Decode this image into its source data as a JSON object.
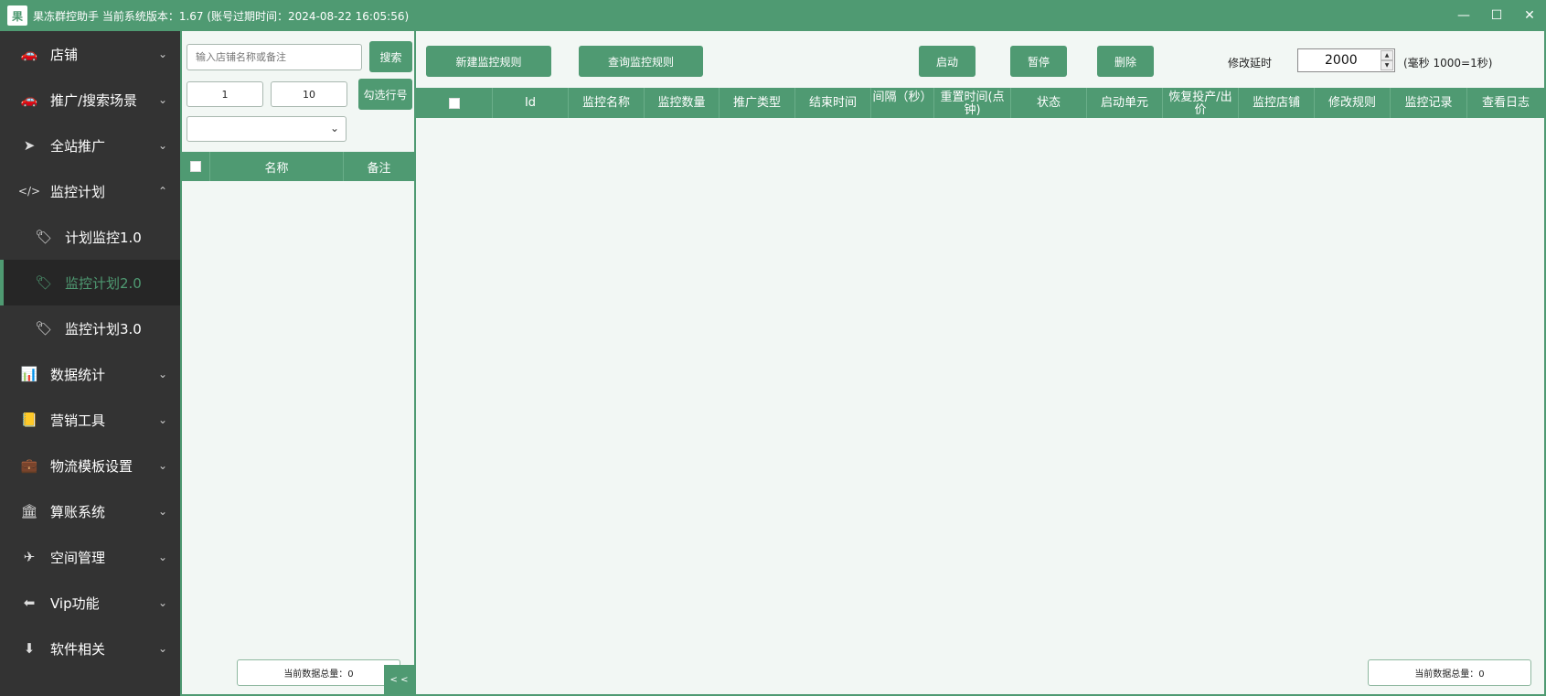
{
  "window": {
    "title": "果冻群控助手 当前系统版本：1.67  (账号过期时间：2024-08-22 16:05:56)",
    "logo_text": "果",
    "controls": {
      "minimize": "—",
      "maximize": "☐",
      "close": "✕"
    }
  },
  "sidebar": {
    "items": [
      {
        "label": "店铺",
        "icon": "car-icon",
        "glyph": "🚗",
        "chevron": "⌄"
      },
      {
        "label": "推广/搜索场景",
        "icon": "car-icon",
        "glyph": "🚗",
        "chevron": "⌄"
      },
      {
        "label": "全站推广",
        "icon": "location-arrow-icon",
        "glyph": "➤",
        "chevron": "⌄"
      },
      {
        "label": "监控计划",
        "icon": "code-icon",
        "glyph": "</>",
        "chevron": "⌃"
      },
      {
        "label": "计划监控1.0",
        "icon": "tag-icon",
        "glyph": "🏷"
      },
      {
        "label": "监控计划2.0",
        "icon": "tag-icon",
        "glyph": "🏷",
        "active": true
      },
      {
        "label": "监控计划3.0",
        "icon": "tag-icon",
        "glyph": "🏷"
      },
      {
        "label": "数据统计",
        "icon": "bar-chart-icon",
        "glyph": "📊",
        "chevron": "⌄"
      },
      {
        "label": "营销工具",
        "icon": "contact-book-icon",
        "glyph": "📒",
        "chevron": "⌄"
      },
      {
        "label": "物流模板设置",
        "icon": "briefcase-icon",
        "glyph": "💼",
        "chevron": "⌄"
      },
      {
        "label": "算账系统",
        "icon": "bank-icon",
        "glyph": "🏛",
        "chevron": "⌄"
      },
      {
        "label": "空间管理",
        "icon": "plane-icon",
        "glyph": "✈",
        "chevron": "⌄"
      },
      {
        "label": "Vip功能",
        "icon": "arrow-left-icon",
        "glyph": "⬅",
        "chevron": "⌄"
      },
      {
        "label": "软件相关",
        "icon": "download-circle-icon",
        "glyph": "⬇",
        "chevron": "⌄"
      }
    ]
  },
  "shop_panel": {
    "search_placeholder": "输入店铺名称或备注",
    "search_button": "搜索",
    "range_from": "1",
    "range_to": "10",
    "check_rows_button": "勾选行号",
    "select_value": "",
    "columns": [
      "名称",
      "备注"
    ],
    "total_label": "当前数据总量：0",
    "collapse_label": "< <"
  },
  "main": {
    "toolbar": {
      "new_rule": "新建监控规则",
      "query_rule": "查询监控规则",
      "start": "启动",
      "pause": "暂停",
      "delete": "删除"
    },
    "delay": {
      "label": "修改延时",
      "value": "2000",
      "note": "(毫秒 1000=1秒)"
    },
    "columns": [
      "Id",
      "监控名称",
      "监控数量",
      "推广类型",
      "结束时间",
      "间隔（秒）",
      "重置时间(点钟)",
      "状态",
      "启动单元",
      "恢复投产/出价",
      "监控店铺",
      "修改规则",
      "监控记录",
      "查看日志"
    ],
    "total_label": "当前数据总量：0"
  },
  "colors": {
    "accent": "#4f9a72",
    "sidebar_bg": "#333333",
    "panel_bg": "#f2f7f4"
  }
}
